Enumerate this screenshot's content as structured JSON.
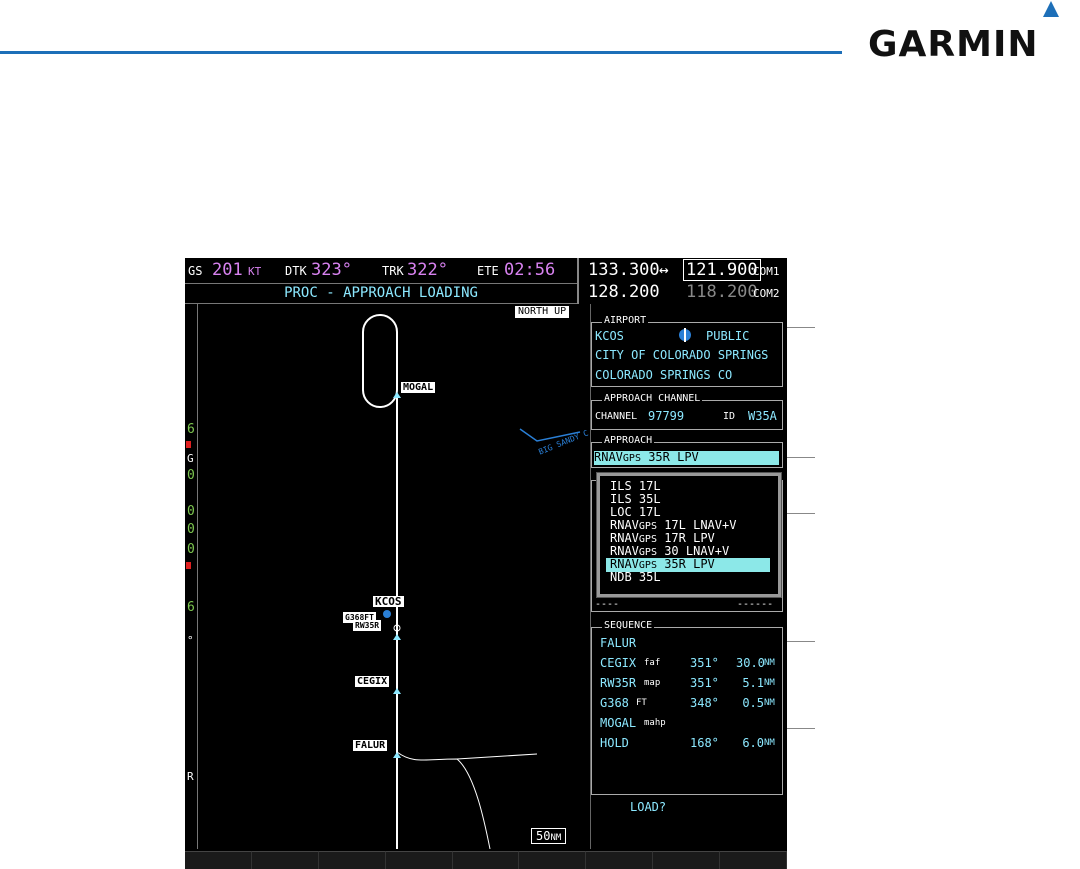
{
  "brand": "GARMIN",
  "navbar": {
    "gs_label": "GS",
    "gs_value": "201",
    "gs_unit": "KT",
    "dtk_label": "DTK",
    "dtk_value": "323°",
    "trk_label": "TRK",
    "trk_value": "322°",
    "ete_label": "ETE",
    "ete_value": "02:56"
  },
  "title": "PROC - APPROACH LOADING",
  "com": {
    "active1": "133.300",
    "arrow": "↔",
    "standby1": "121.900",
    "label1": "COM1",
    "active2": "128.200",
    "standby2": "118.200",
    "label2": "COM2"
  },
  "map": {
    "orientation": "NORTH UP",
    "range": "50",
    "range_unit": "NM",
    "river_label": "BIG SANDY C",
    "waypoints": {
      "mogal": "MOGAL",
      "kcos": "KCOS",
      "g368": "G368FT",
      "rw35r": "RW35R",
      "cegix": "CEGIX",
      "falur": "FALUR"
    },
    "left_glyphs": [
      "6",
      "G",
      "0",
      "0",
      "0",
      "0",
      "6",
      "°",
      "R"
    ]
  },
  "airport": {
    "title": "AIRPORT",
    "id": "KCOS",
    "type": "PUBLIC",
    "city": "CITY OF COLORADO SPRINGS",
    "location": "COLORADO SPRINGS CO"
  },
  "approach_channel": {
    "title": "APPROACH CHANNEL",
    "channel_label": "CHANNEL",
    "channel_value": "97799",
    "id_label": "ID",
    "id_value": "W35A"
  },
  "approach": {
    "title": "APPROACH",
    "selected_prefix": "RNAV",
    "selected_sub": "GPS",
    "selected_rest": " 35R LPV"
  },
  "approach_list": [
    {
      "prefix": "ILS 17L",
      "sub": "",
      "rest": ""
    },
    {
      "prefix": "ILS 35L",
      "sub": "",
      "rest": ""
    },
    {
      "prefix": "LOC 17L",
      "sub": "",
      "rest": ""
    },
    {
      "prefix": "RNAV",
      "sub": "GPS",
      "rest": " 17L LNAV+V"
    },
    {
      "prefix": "RNAV",
      "sub": "GPS",
      "rest": " 17R LPV"
    },
    {
      "prefix": "RNAV",
      "sub": "GPS",
      "rest": " 30 LNAV+V"
    },
    {
      "prefix": "RNAV",
      "sub": "GPS",
      "rest": " 35R LPV"
    },
    {
      "prefix": "NDB 35L",
      "sub": "",
      "rest": ""
    }
  ],
  "transitions_placeholder": {
    "left": "----",
    "right": "------"
  },
  "sequence": {
    "title": "SEQUENCE",
    "rows": [
      {
        "name": "FALUR",
        "tag": "",
        "course": "",
        "dist": "",
        "unit": ""
      },
      {
        "name": "CEGIX",
        "tag": "faf",
        "course": "351°",
        "dist": "30.0",
        "unit": "NM"
      },
      {
        "name": "RW35R",
        "tag": "map",
        "course": "351°",
        "dist": "5.1",
        "unit": "NM"
      },
      {
        "name": "G368",
        "tag": "FT",
        "course": "348°",
        "dist": "0.5",
        "unit": "NM"
      },
      {
        "name": "MOGAL",
        "tag": "mahp",
        "course": "",
        "dist": "",
        "unit": ""
      },
      {
        "name": "HOLD",
        "tag": "",
        "course": "168°",
        "dist": "6.0",
        "unit": "NM"
      }
    ]
  },
  "load_prompt": "LOAD?"
}
